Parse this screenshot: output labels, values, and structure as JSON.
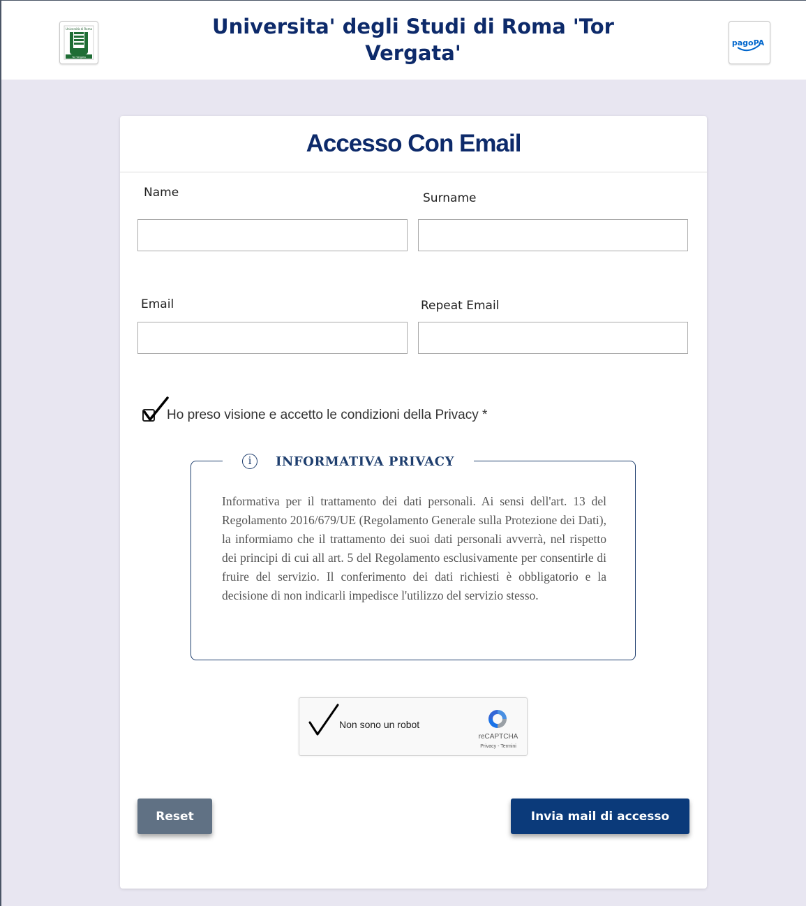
{
  "header": {
    "title": "Universita' degli Studi di Roma 'Tor Vergata'",
    "left_logo": "university-logo",
    "left_logo_text_top": "Università di Roma",
    "left_logo_text_bottom": "Tor Vergata",
    "right_logo": "pagopa-logo",
    "right_logo_text": "pagoPA"
  },
  "card": {
    "title": "Accesso Con Email"
  },
  "form": {
    "name_label": "Name",
    "name_value": "",
    "surname_label": "Surname",
    "surname_value": "",
    "email_label": "Email",
    "email_value": "",
    "repeat_email_label": "Repeat Email",
    "repeat_email_value": "",
    "privacy_checkbox_label": "Ho preso visione e accetto le condizioni della Privacy *",
    "privacy_checked": true
  },
  "privacy_info": {
    "icon": "info-icon",
    "title": "INFORMATIVA PRIVACY",
    "text": "Informativa per il trattamento dei dati personali. Ai sensi dell'art. 13 del Regolamento 2016/679/UE (Regolamento Generale sulla Protezione dei Dati), la informiamo che il trattamento dei suoi dati personali avverrà, nel rispetto dei principi di cui all art. 5 del Regolamento esclusivamente per consentirle di fruire del servizio. Il conferimento dei dati richiesti è obbligatorio e la decisione di non indicarli impedisce l'utilizzo del servizio stesso."
  },
  "captcha": {
    "label": "Non sono un robot",
    "brand": "reCAPTCHA",
    "terms": "Privacy - Termini",
    "checked": true
  },
  "buttons": {
    "reset_label": "Reset",
    "send_label": "Invia mail di accesso"
  },
  "colors": {
    "brand_navy": "#0d2a6a",
    "send_button": "#0b3a7a",
    "reset_button": "#607184",
    "page_background": "#e8e6f1"
  }
}
